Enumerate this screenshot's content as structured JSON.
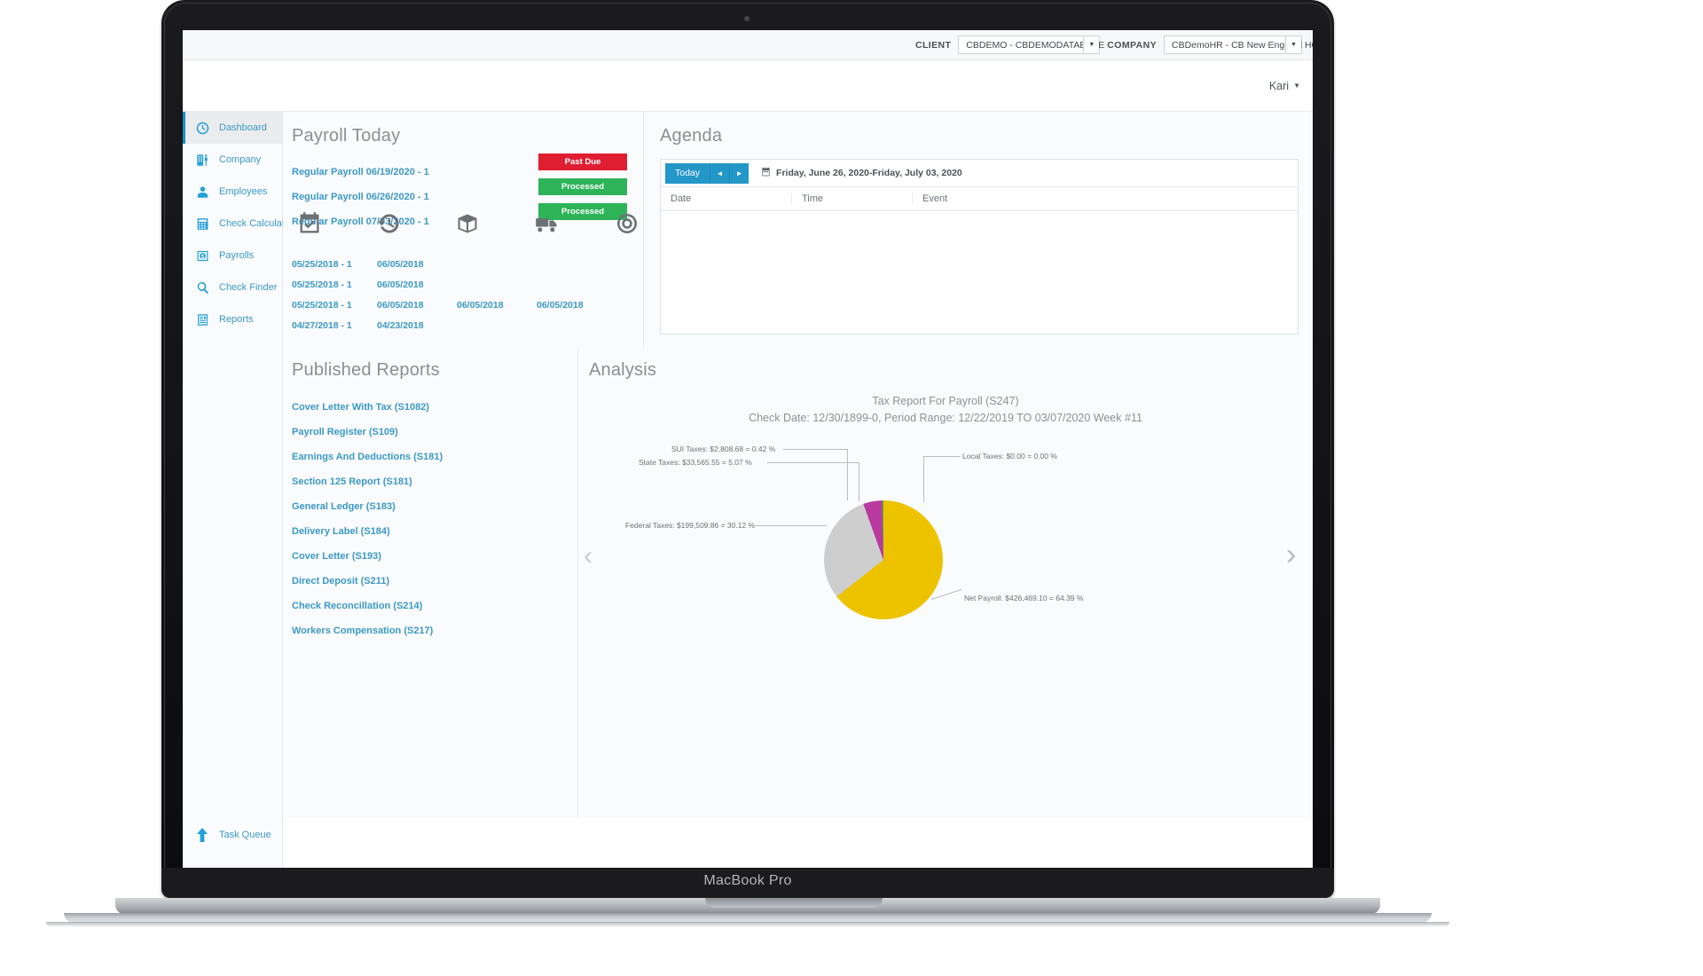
{
  "device": {
    "wordmark": "MacBook Pro"
  },
  "topbar": {
    "client_label": "CLIENT",
    "client_value": "CBDEMO - CBDEMODATABASE",
    "company_label": "COMPANY",
    "company_value": "CBDemoHR - CB New England HCM",
    "caret_icon": "chevron-down-icon"
  },
  "userbar": {
    "user_name": "Kari",
    "caret_icon": "chevron-down-icon"
  },
  "sidebar": {
    "items": [
      {
        "label": "Dashboard",
        "icon": "dashboard-clock-icon",
        "active": true
      },
      {
        "label": "Company",
        "icon": "company-building-icon",
        "active": false
      },
      {
        "label": "Employees",
        "icon": "employee-person-icon",
        "active": false
      },
      {
        "label": "Check Calculator",
        "icon": "calculator-icon",
        "active": false
      },
      {
        "label": "Payrolls",
        "icon": "payrolls-money-icon",
        "active": false
      },
      {
        "label": "Check Finder",
        "icon": "search-magnifier-icon",
        "active": false
      },
      {
        "label": "Reports",
        "icon": "reports-document-icon",
        "active": false
      }
    ],
    "task_queue": {
      "label": "Task Queue",
      "icon": "upload-arrow-icon"
    }
  },
  "payroll_today": {
    "title": "Payroll Today",
    "rows": [
      {
        "label": "Regular Payroll 06/19/2020 - 1",
        "status": "Past Due",
        "status_color": "#e01e32"
      },
      {
        "label": "Regular Payroll 06/26/2020 - 1",
        "status": "Processed",
        "status_color": "#2eb359"
      },
      {
        "label": "Regular Payroll 07/03/2020 - 1",
        "status": "Processed",
        "status_color": "#2eb359"
      }
    ],
    "status_icons": [
      "calendar-check-icon",
      "clock-history-icon",
      "package-box-icon",
      "delivery-truck-icon",
      "target-bullseye-icon"
    ],
    "date_grid": [
      [
        "05/25/2018 - 1",
        "06/05/2018",
        "",
        ""
      ],
      [
        "05/25/2018 - 1",
        "06/05/2018",
        "",
        ""
      ],
      [
        "05/25/2018 - 1",
        "06/05/2018",
        "06/05/2018",
        "06/05/2018"
      ],
      [
        "04/27/2018 - 1",
        "04/23/2018",
        "",
        ""
      ]
    ]
  },
  "agenda": {
    "title": "Agenda",
    "today_button": "Today",
    "prev_button": "◄",
    "next_button": "►",
    "calendar_icon": "calendar-icon",
    "range": "Friday, June 26, 2020-Friday, July 03, 2020",
    "columns": [
      "Date",
      "Time",
      "Event"
    ],
    "rows": []
  },
  "published_reports": {
    "title": "Published Reports",
    "items": [
      "Cover Letter With Tax (S1082)",
      "Payroll Register (S109)",
      "Earnings And Deductions (S181)",
      "Section 125 Report (S181)",
      "General Ledger (S183)",
      "Delivery Label (S184)",
      "Cover Letter (S193)",
      "Direct Deposit (S211)",
      "Check Reconcillation (S214)",
      "Workers Compensation (S217)"
    ]
  },
  "analysis": {
    "title": "Analysis",
    "prev_icon": "chevron-left-icon",
    "next_icon": "chevron-right-icon"
  },
  "chart_data": {
    "type": "pie",
    "title": "Tax Report For Payroll (S247)",
    "subtitle": "Check Date: 12/30/1899-0, Period Range: 12/22/2019 TO 03/07/2020 Week #11",
    "legend_position": "callout-labels",
    "slices": [
      {
        "name": "SUI Taxes",
        "label": "SUI Taxes: $2,808.68 = 0.42 %",
        "amount": 2808.68,
        "percent": 0.42,
        "color": "#5ba83c"
      },
      {
        "name": "State Taxes",
        "label": "State Taxes: $33,565.55 = 5.07 %",
        "amount": 33565.55,
        "percent": 5.07,
        "color": "#b83aa0"
      },
      {
        "name": "Local Taxes",
        "label": "Local Taxes: $0.00 = 0.00 %",
        "amount": 0.0,
        "percent": 0.0,
        "color": "#4e8fd0"
      },
      {
        "name": "Federal Taxes",
        "label": "Federal Taxes: $199,509.86 = 30.12 %",
        "amount": 199509.86,
        "percent": 30.12,
        "color": "#cecece"
      },
      {
        "name": "Net Payroll",
        "label": "Net Payroll: $426,469.10 = 64.39 %",
        "amount": 426469.1,
        "percent": 64.39,
        "color": "#edc300"
      }
    ]
  }
}
